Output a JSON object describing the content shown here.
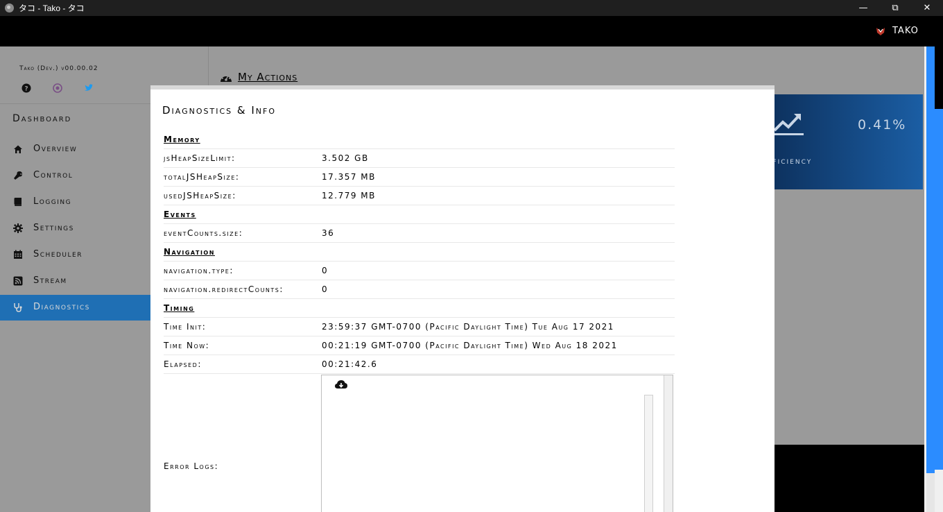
{
  "window": {
    "title": "タコ - Tako - タコ",
    "minimize": "—",
    "maximize": "⧉",
    "close": "✕"
  },
  "header": {
    "brand": "TAKO"
  },
  "sidebar": {
    "version": "Tako (Dev.) v00.00.02",
    "section_title": "Dashboard",
    "items": [
      {
        "label": "Overview",
        "icon": "home-icon"
      },
      {
        "label": "Control",
        "icon": "wrench-icon"
      },
      {
        "label": "Logging",
        "icon": "book-icon"
      },
      {
        "label": "Settings",
        "icon": "gear-icon"
      },
      {
        "label": "Scheduler",
        "icon": "calendar-icon"
      },
      {
        "label": "Stream",
        "icon": "rss-icon"
      },
      {
        "label": "Diagnostics",
        "icon": "stethoscope-icon",
        "active": true
      }
    ]
  },
  "main": {
    "actions_title": "My Actions",
    "card": {
      "value": "0.41%",
      "label": "Efficiency"
    }
  },
  "modal": {
    "title": "Diagnostics & Info",
    "sections": {
      "memory": "Memory",
      "events": "Events",
      "navigation": "Navigation",
      "timing": "Timing"
    },
    "rows": {
      "heap_limit_key": "jsHeapSizeLimit:",
      "heap_limit_val": "3.502 GB",
      "total_heap_key": "totalJSHeapSize:",
      "total_heap_val": "17.357 MB",
      "used_heap_key": "usedJSHeapSize:",
      "used_heap_val": "12.779 MB",
      "event_counts_key": "eventCounts.size:",
      "event_counts_val": "36",
      "nav_type_key": "navigation.type:",
      "nav_type_val": "0",
      "nav_redirect_key": "navigation.redirectCounts:",
      "nav_redirect_val": "0",
      "time_init_key": "Time Init:",
      "time_init_val": "23:59:37 GMT-0700 (Pacific Daylight Time) Tue Aug 17 2021",
      "time_now_key": "Time Now:",
      "time_now_val": "00:21:19 GMT-0700 (Pacific Daylight Time) Wed Aug 18 2021",
      "elapsed_key": "Elapsed:",
      "elapsed_val": "00:21:42.6"
    },
    "error_logs_label": "Error Logs:"
  },
  "colors": {
    "accent": "#1f6fb4",
    "scroll": "#2b8cff",
    "card_dark": "#0c2e59",
    "card_light": "#1b5ea4"
  }
}
